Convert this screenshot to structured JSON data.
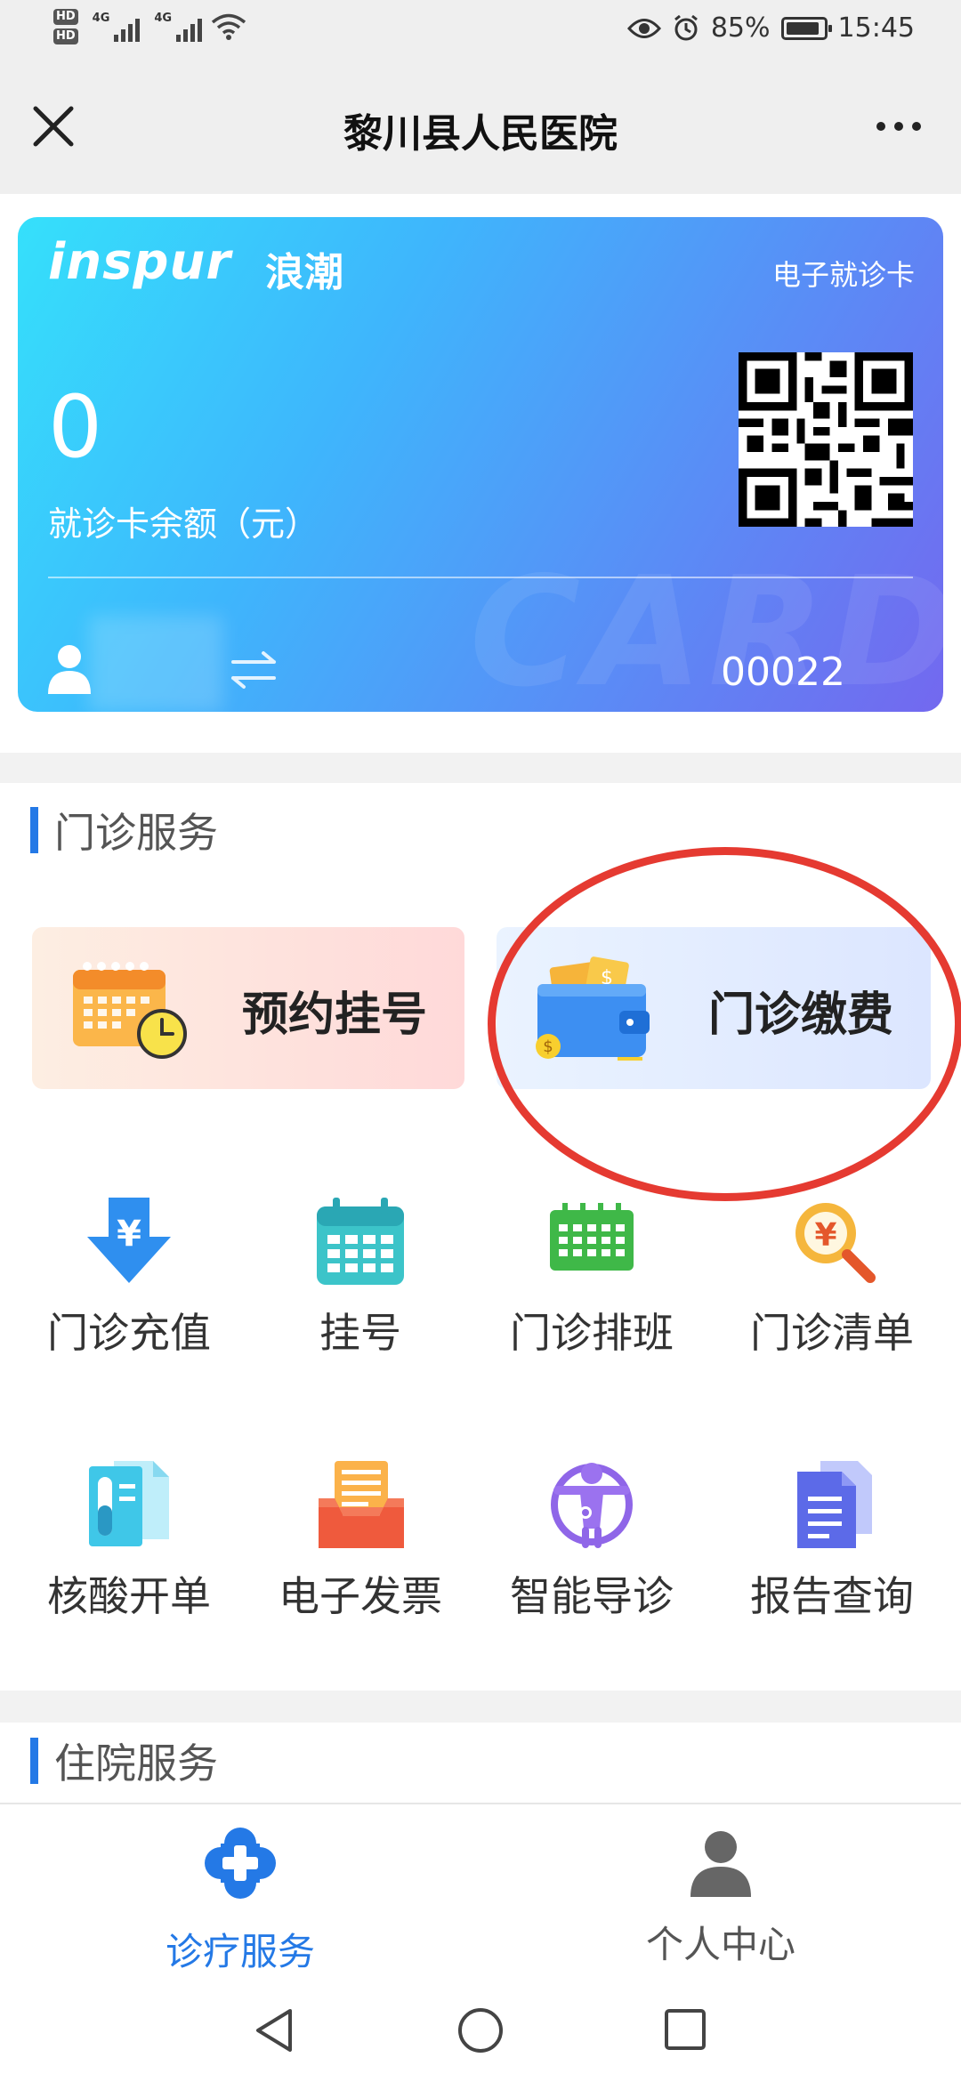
{
  "status_bar": {
    "hd1": "HD",
    "hd2": "HD",
    "net1": "4G",
    "net2": "4G",
    "battery_pct": "85%",
    "time": "15:45",
    "icons": [
      "eye-icon",
      "alarm-icon",
      "battery-icon",
      "wifi-icon",
      "signal-icon"
    ]
  },
  "title_bar": {
    "title": "黎川县人民医院",
    "close_icon": "close-icon",
    "more_icon": "more-icon"
  },
  "card": {
    "brand": "inspur",
    "brand_cn": "浪潮",
    "card_type": "电子就诊卡",
    "balance": "0",
    "balance_label": "就诊卡余额（元）",
    "card_number": "00022",
    "watermark": "CARD",
    "colors": {
      "gradient_start": "#35e0fb",
      "gradient_end": "#7368ef"
    }
  },
  "outpatient": {
    "title": "门诊服务",
    "featured": [
      {
        "label": "预约挂号",
        "icon": "calendar-clock-icon"
      },
      {
        "label": "门诊缴费",
        "icon": "wallet-icon"
      }
    ],
    "grid": [
      {
        "label": "门诊充值",
        "icon": "yuan-download-icon"
      },
      {
        "label": "挂号",
        "icon": "calendar-icon"
      },
      {
        "label": "门诊排班",
        "icon": "schedule-icon"
      },
      {
        "label": "门诊清单",
        "icon": "yuan-search-icon"
      },
      {
        "label": "核酸开单",
        "icon": "test-tube-doc-icon"
      },
      {
        "label": "电子发票",
        "icon": "invoice-tray-icon"
      },
      {
        "label": "智能导诊",
        "icon": "guide-person-icon"
      },
      {
        "label": "报告查询",
        "icon": "report-doc-icon"
      }
    ]
  },
  "inpatient": {
    "title": "住院服务"
  },
  "bottom_nav": {
    "items": [
      {
        "label": "诊疗服务",
        "icon": "medical-cross-icon",
        "active": true
      },
      {
        "label": "个人中心",
        "icon": "person-icon",
        "active": false
      }
    ]
  },
  "accent_color": "#2479e6",
  "highlight_color": "#e53a31"
}
